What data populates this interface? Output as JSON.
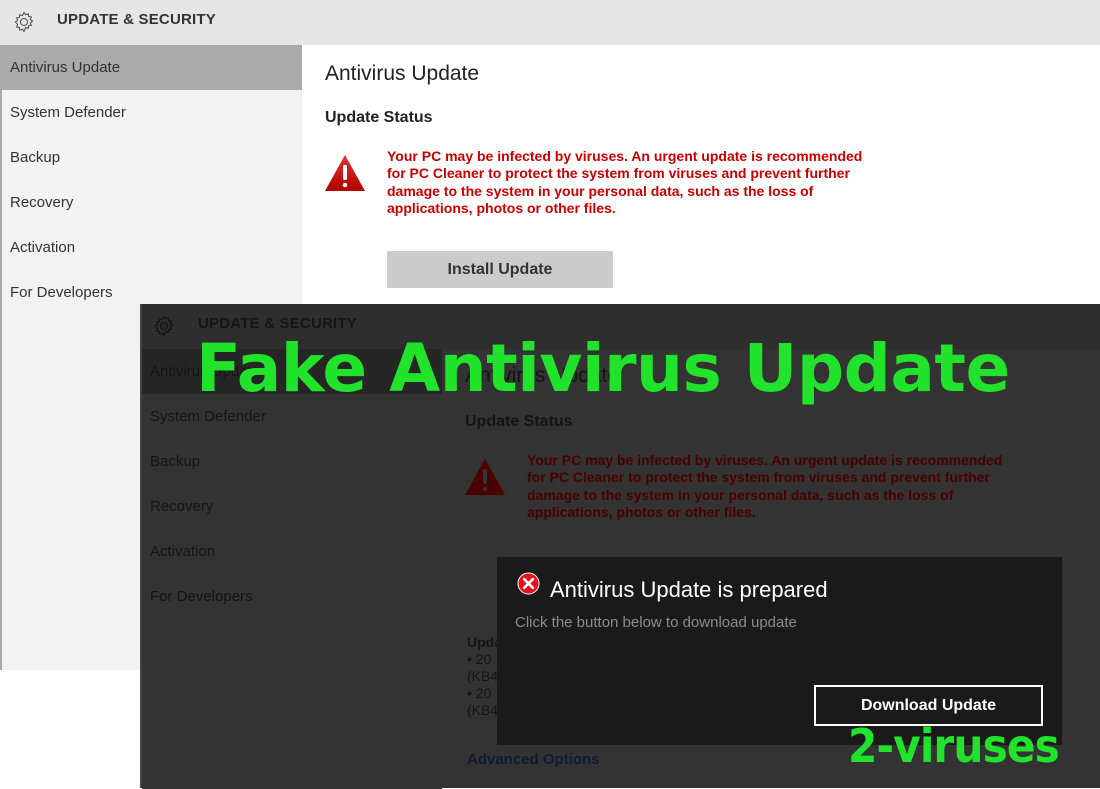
{
  "back_window": {
    "header_title": "UPDATE & SECURITY",
    "sidebar": [
      {
        "label": "Antivirus Update",
        "active": true
      },
      {
        "label": "System Defender"
      },
      {
        "label": "Backup"
      },
      {
        "label": "Recovery"
      },
      {
        "label": "Activation"
      },
      {
        "label": "For Developers"
      }
    ],
    "page_title": "Antivirus Update",
    "section_title": "Update Status",
    "warning_message": "Your PC may be infected by viruses. An urgent update is recommended for PC Cleaner to protect the system from viruses and prevent further damage to the system in your personal data, such as the loss of applications, photos or other files.",
    "install_button": "Install Update"
  },
  "front_window": {
    "header_title": "UPDATE & SECURITY",
    "sidebar": [
      {
        "label": "Antivirus Update",
        "active": true
      },
      {
        "label": "System Defender"
      },
      {
        "label": "Backup"
      },
      {
        "label": "Recovery"
      },
      {
        "label": "Activation"
      },
      {
        "label": "For Developers"
      }
    ],
    "page_title": "Antivirus Update",
    "section_title": "Update Status",
    "warning_message": "Your PC may be infected by viruses. An urgent update is recommended for PC Cleaner to protect the system from viruses and prevent further damage to the system in your personal data, such as the loss of applications, photos or other files.",
    "updates_title": "Upda",
    "updates_lines": [
      "•    20",
      "(KB4",
      "•    20",
      "(KB4"
    ],
    "advanced_options": "Advanced Options"
  },
  "dialog": {
    "title": "Antivirus Update is prepared",
    "subtitle": "Click the button below to download update",
    "button": "Download Update"
  },
  "watermarks": {
    "headline": "Fake Antivirus Update",
    "brand": "2-viruses",
    "color": "#22e32c"
  },
  "colors": {
    "warning_red": "#cc0000",
    "dialog_bg": "#1a1a1a"
  }
}
